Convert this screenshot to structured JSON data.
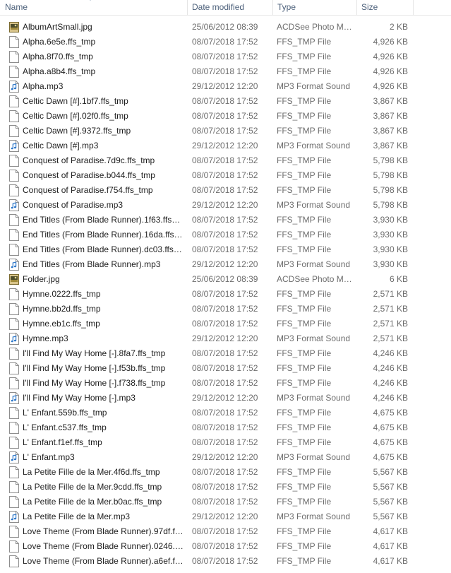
{
  "columns": {
    "name": "Name",
    "date": "Date modified",
    "type": "Type",
    "size": "Size"
  },
  "icons": {
    "blank": "blank-file-icon",
    "mp3": "audio-file-icon",
    "jpg": "image-file-icon"
  },
  "files": [
    {
      "name": "AlbumArtSmall.jpg",
      "date": "25/06/2012 08:39",
      "type": "ACDSee Photo Ma...",
      "size": "2 KB",
      "icon": "jpg"
    },
    {
      "name": "Alpha.6e5e.ffs_tmp",
      "date": "08/07/2018 17:52",
      "type": "FFS_TMP File",
      "size": "4,926 KB",
      "icon": "blank"
    },
    {
      "name": "Alpha.8f70.ffs_tmp",
      "date": "08/07/2018 17:52",
      "type": "FFS_TMP File",
      "size": "4,926 KB",
      "icon": "blank"
    },
    {
      "name": "Alpha.a8b4.ffs_tmp",
      "date": "08/07/2018 17:52",
      "type": "FFS_TMP File",
      "size": "4,926 KB",
      "icon": "blank"
    },
    {
      "name": "Alpha.mp3",
      "date": "29/12/2012 12:20",
      "type": "MP3 Format Sound",
      "size": "4,926 KB",
      "icon": "mp3"
    },
    {
      "name": "Celtic Dawn [#].1bf7.ffs_tmp",
      "date": "08/07/2018 17:52",
      "type": "FFS_TMP File",
      "size": "3,867 KB",
      "icon": "blank"
    },
    {
      "name": "Celtic Dawn [#].02f0.ffs_tmp",
      "date": "08/07/2018 17:52",
      "type": "FFS_TMP File",
      "size": "3,867 KB",
      "icon": "blank"
    },
    {
      "name": "Celtic Dawn [#].9372.ffs_tmp",
      "date": "08/07/2018 17:52",
      "type": "FFS_TMP File",
      "size": "3,867 KB",
      "icon": "blank"
    },
    {
      "name": "Celtic Dawn [#].mp3",
      "date": "29/12/2012 12:20",
      "type": "MP3 Format Sound",
      "size": "3,867 KB",
      "icon": "mp3"
    },
    {
      "name": "Conquest of Paradise.7d9c.ffs_tmp",
      "date": "08/07/2018 17:52",
      "type": "FFS_TMP File",
      "size": "5,798 KB",
      "icon": "blank"
    },
    {
      "name": "Conquest of Paradise.b044.ffs_tmp",
      "date": "08/07/2018 17:52",
      "type": "FFS_TMP File",
      "size": "5,798 KB",
      "icon": "blank"
    },
    {
      "name": "Conquest of Paradise.f754.ffs_tmp",
      "date": "08/07/2018 17:52",
      "type": "FFS_TMP File",
      "size": "5,798 KB",
      "icon": "blank"
    },
    {
      "name": "Conquest of Paradise.mp3",
      "date": "29/12/2012 12:20",
      "type": "MP3 Format Sound",
      "size": "5,798 KB",
      "icon": "mp3"
    },
    {
      "name": "End Titles (From Blade Runner).1f63.ffs_t...",
      "date": "08/07/2018 17:52",
      "type": "FFS_TMP File",
      "size": "3,930 KB",
      "icon": "blank"
    },
    {
      "name": "End Titles (From Blade Runner).16da.ffs_t...",
      "date": "08/07/2018 17:52",
      "type": "FFS_TMP File",
      "size": "3,930 KB",
      "icon": "blank"
    },
    {
      "name": "End Titles (From Blade Runner).dc03.ffs_t...",
      "date": "08/07/2018 17:52",
      "type": "FFS_TMP File",
      "size": "3,930 KB",
      "icon": "blank"
    },
    {
      "name": "End Titles (From Blade Runner).mp3",
      "date": "29/12/2012 12:20",
      "type": "MP3 Format Sound",
      "size": "3,930 KB",
      "icon": "mp3"
    },
    {
      "name": "Folder.jpg",
      "date": "25/06/2012 08:39",
      "type": "ACDSee Photo Ma...",
      "size": "6 KB",
      "icon": "jpg"
    },
    {
      "name": "Hymne.0222.ffs_tmp",
      "date": "08/07/2018 17:52",
      "type": "FFS_TMP File",
      "size": "2,571 KB",
      "icon": "blank"
    },
    {
      "name": "Hymne.bb2d.ffs_tmp",
      "date": "08/07/2018 17:52",
      "type": "FFS_TMP File",
      "size": "2,571 KB",
      "icon": "blank"
    },
    {
      "name": "Hymne.eb1c.ffs_tmp",
      "date": "08/07/2018 17:52",
      "type": "FFS_TMP File",
      "size": "2,571 KB",
      "icon": "blank"
    },
    {
      "name": "Hymne.mp3",
      "date": "29/12/2012 12:20",
      "type": "MP3 Format Sound",
      "size": "2,571 KB",
      "icon": "mp3"
    },
    {
      "name": "I'll Find My Way Home [-].8fa7.ffs_tmp",
      "date": "08/07/2018 17:52",
      "type": "FFS_TMP File",
      "size": "4,246 KB",
      "icon": "blank"
    },
    {
      "name": "I'll Find My Way Home [-].f53b.ffs_tmp",
      "date": "08/07/2018 17:52",
      "type": "FFS_TMP File",
      "size": "4,246 KB",
      "icon": "blank"
    },
    {
      "name": "I'll Find My Way Home [-].f738.ffs_tmp",
      "date": "08/07/2018 17:52",
      "type": "FFS_TMP File",
      "size": "4,246 KB",
      "icon": "blank"
    },
    {
      "name": "I'll Find My Way Home [-].mp3",
      "date": "29/12/2012 12:20",
      "type": "MP3 Format Sound",
      "size": "4,246 KB",
      "icon": "mp3"
    },
    {
      "name": "L' Enfant.559b.ffs_tmp",
      "date": "08/07/2018 17:52",
      "type": "FFS_TMP File",
      "size": "4,675 KB",
      "icon": "blank"
    },
    {
      "name": "L' Enfant.c537.ffs_tmp",
      "date": "08/07/2018 17:52",
      "type": "FFS_TMP File",
      "size": "4,675 KB",
      "icon": "blank"
    },
    {
      "name": "L' Enfant.f1ef.ffs_tmp",
      "date": "08/07/2018 17:52",
      "type": "FFS_TMP File",
      "size": "4,675 KB",
      "icon": "blank"
    },
    {
      "name": "L' Enfant.mp3",
      "date": "29/12/2012 12:20",
      "type": "MP3 Format Sound",
      "size": "4,675 KB",
      "icon": "mp3"
    },
    {
      "name": "La Petite Fille de la Mer.4f6d.ffs_tmp",
      "date": "08/07/2018 17:52",
      "type": "FFS_TMP File",
      "size": "5,567 KB",
      "icon": "blank"
    },
    {
      "name": "La Petite Fille de la Mer.9cdd.ffs_tmp",
      "date": "08/07/2018 17:52",
      "type": "FFS_TMP File",
      "size": "5,567 KB",
      "icon": "blank"
    },
    {
      "name": "La Petite Fille de la Mer.b0ac.ffs_tmp",
      "date": "08/07/2018 17:52",
      "type": "FFS_TMP File",
      "size": "5,567 KB",
      "icon": "blank"
    },
    {
      "name": "La Petite Fille de la Mer.mp3",
      "date": "29/12/2012 12:20",
      "type": "MP3 Format Sound",
      "size": "5,567 KB",
      "icon": "mp3"
    },
    {
      "name": "Love Theme (From Blade Runner).97df.ffs...",
      "date": "08/07/2018 17:52",
      "type": "FFS_TMP File",
      "size": "4,617 KB",
      "icon": "blank"
    },
    {
      "name": "Love Theme (From Blade Runner).0246.ffs...",
      "date": "08/07/2018 17:52",
      "type": "FFS_TMP File",
      "size": "4,617 KB",
      "icon": "blank"
    },
    {
      "name": "Love Theme (From Blade Runner).a6ef.ffs...",
      "date": "08/07/2018 17:52",
      "type": "FFS_TMP File",
      "size": "4,617 KB",
      "icon": "blank"
    }
  ]
}
